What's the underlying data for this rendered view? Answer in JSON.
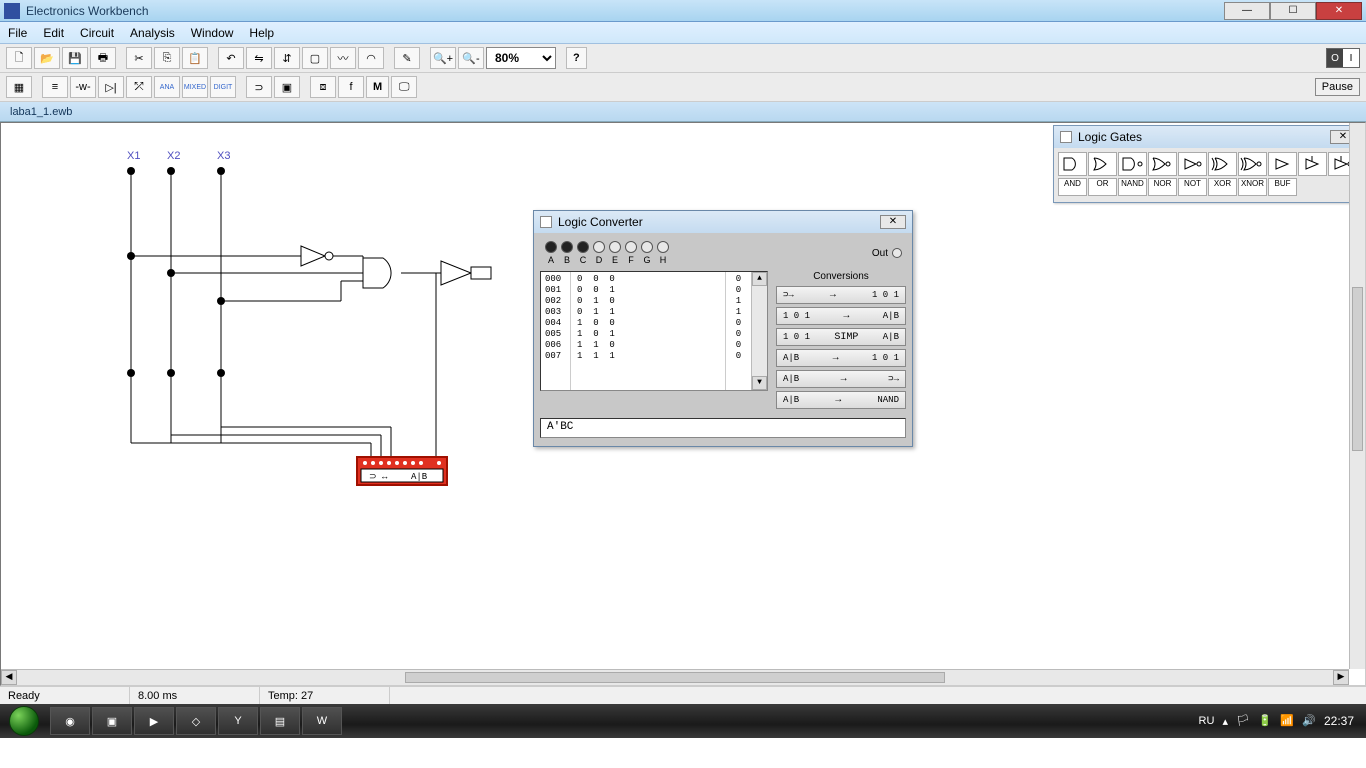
{
  "window": {
    "title": "Electronics Workbench",
    "controls": {
      "min": "—",
      "max": "☐",
      "close": "✕"
    }
  },
  "menu": [
    "File",
    "Edit",
    "Circuit",
    "Analysis",
    "Window",
    "Help"
  ],
  "toolbar1": {
    "zoom": "80%",
    "help": "?"
  },
  "toolbar2": {
    "pause": "Pause",
    "groups": [
      "ANA",
      "MIXED",
      "DIGIT"
    ]
  },
  "document": {
    "name": "laba1_1.ewb"
  },
  "circuit": {
    "inputs": [
      "X1",
      "X2",
      "X3"
    ],
    "converter_label": "A|B"
  },
  "logic_gates_palette": {
    "title": "Logic Gates",
    "labels": [
      "AND",
      "OR",
      "NAND",
      "NOR",
      "NOT",
      "XOR",
      "XNOR",
      "BUF"
    ]
  },
  "logic_converter": {
    "title": "Logic Converter",
    "out_label": "Out",
    "terminals": [
      "A",
      "B",
      "C",
      "D",
      "E",
      "F",
      "G",
      "H"
    ],
    "active_terminals": 3,
    "truth_table": {
      "rows": [
        {
          "idx": "000",
          "bits": "0  0  0",
          "out": "0"
        },
        {
          "idx": "001",
          "bits": "0  0  1",
          "out": "0"
        },
        {
          "idx": "002",
          "bits": "0  1  0",
          "out": "1"
        },
        {
          "idx": "003",
          "bits": "0  1  1",
          "out": "1"
        },
        {
          "idx": "004",
          "bits": "1  0  0",
          "out": "0"
        },
        {
          "idx": "005",
          "bits": "1  0  1",
          "out": "0"
        },
        {
          "idx": "006",
          "bits": "1  1  0",
          "out": "0"
        },
        {
          "idx": "007",
          "bits": "1  1  1",
          "out": "0"
        }
      ]
    },
    "conversions_title": "Conversions",
    "buttons": [
      {
        "left": "⊃→",
        "right": "1 0 1"
      },
      {
        "left": "1 0 1",
        "right": "A|B"
      },
      {
        "left": "1 0 1",
        "mid": "SIMP",
        "right": "A|B"
      },
      {
        "left": "A|B",
        "right": "1 0 1"
      },
      {
        "left": "A|B",
        "right": "⊃→"
      },
      {
        "left": "A|B",
        "right": "NAND"
      }
    ],
    "expression": "A'BC"
  },
  "statusbar": {
    "ready": "Ready",
    "time": "8.00 ms",
    "temp": "Temp: 27"
  },
  "taskbar": {
    "lang": "RU",
    "clock": "22:37"
  }
}
